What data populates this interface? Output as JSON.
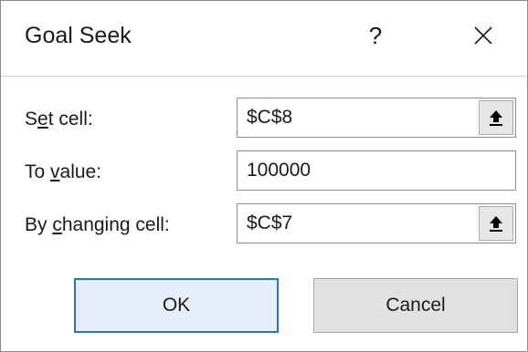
{
  "dialog": {
    "title": "Goal Seek",
    "help_label": "?",
    "close_icon": "close-icon"
  },
  "set_cell": {
    "label_pre": "S",
    "label_mnemonic": "e",
    "label_post": "t cell:",
    "value": "$C$8",
    "button_icon": "collapse-dialog-icon"
  },
  "to_value": {
    "label_pre": "To ",
    "label_mnemonic": "v",
    "label_post": "alue:",
    "value": "100000"
  },
  "changing_cell": {
    "label_pre": "By ",
    "label_mnemonic": "c",
    "label_post": "hanging cell:",
    "value": "$C$7",
    "button_icon": "collapse-dialog-icon"
  },
  "buttons": {
    "ok_label": "OK",
    "cancel_label": "Cancel"
  },
  "colors": {
    "default_button_border": "#2f6fd1",
    "button_face": "#e1e1e1"
  }
}
